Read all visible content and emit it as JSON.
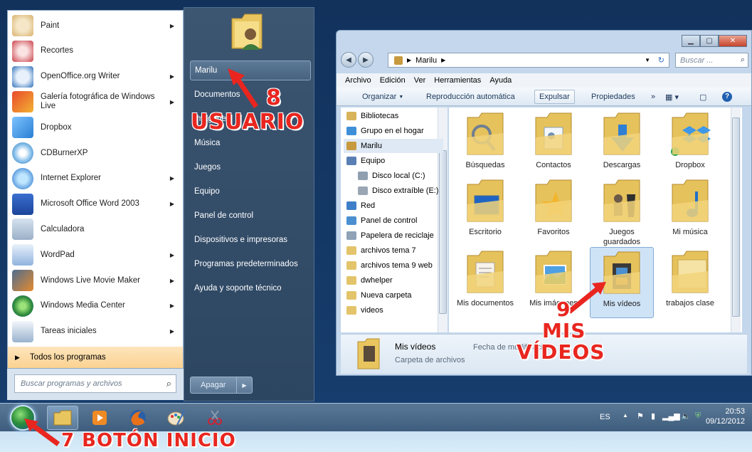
{
  "start_menu": {
    "programs": [
      {
        "label": "Paint",
        "submenu": true,
        "icon": "paint-icon"
      },
      {
        "label": "Recortes",
        "submenu": false,
        "icon": "scissors-icon"
      },
      {
        "label": "OpenOffice.org Writer",
        "submenu": true,
        "icon": "writer-icon"
      },
      {
        "label": "Galería fotográfica de Windows Live",
        "submenu": true,
        "icon": "photo-gallery-icon"
      },
      {
        "label": "Dropbox",
        "submenu": false,
        "icon": "dropbox-icon"
      },
      {
        "label": "CDBurnerXP",
        "submenu": false,
        "icon": "cd-icon"
      },
      {
        "label": "Internet Explorer",
        "submenu": true,
        "icon": "ie-icon"
      },
      {
        "label": "Microsoft Office Word 2003",
        "submenu": true,
        "icon": "word-icon"
      },
      {
        "label": "Calculadora",
        "submenu": false,
        "icon": "calculator-icon"
      },
      {
        "label": "WordPad",
        "submenu": true,
        "icon": "wordpad-icon"
      },
      {
        "label": "Windows Live Movie Maker",
        "submenu": true,
        "icon": "movie-maker-icon"
      },
      {
        "label": "Windows Media Center",
        "submenu": true,
        "icon": "media-center-icon"
      },
      {
        "label": "Tareas iniciales",
        "submenu": true,
        "icon": "tasks-icon"
      }
    ],
    "all_programs": "Todos los programas",
    "search_placeholder": "Buscar programas y archivos",
    "right_items": [
      "Marilu",
      "Documentos",
      "Imágenes",
      "Música",
      "Juegos",
      "Equipo",
      "Panel de control",
      "Dispositivos e impresoras",
      "Programas predeterminados",
      "Ayuda y soporte técnico"
    ],
    "shutdown": "Apagar"
  },
  "explorer": {
    "address": [
      "Marilu"
    ],
    "search_placeholder": "Buscar ...",
    "menu": [
      "Archivo",
      "Edición",
      "Ver",
      "Herramientas",
      "Ayuda"
    ],
    "commands": {
      "organize": "Organizar",
      "autoplay": "Reproducción automática",
      "eject": "Expulsar",
      "properties": "Propiedades"
    },
    "nav_items": [
      {
        "label": "Bibliotecas",
        "color": "#d9b35a"
      },
      {
        "label": "Grupo en el hogar",
        "color": "#3f8fd8"
      },
      {
        "label": "Marilu",
        "color": "#c79a3f"
      },
      {
        "label": "Equipo",
        "color": "#5a7fb5"
      },
      {
        "label": "Disco local (C:)",
        "color": "#8f9fb0"
      },
      {
        "label": "Disco extraíble (E:)",
        "color": "#9aa6b3"
      },
      {
        "label": "Red",
        "color": "#3f7fc8"
      },
      {
        "label": "Panel de control",
        "color": "#4b8fd0"
      },
      {
        "label": "Papelera de reciclaje",
        "color": "#8fa2b6"
      },
      {
        "label": "archivos tema 7",
        "color": "#e3c46a"
      },
      {
        "label": "archivos tema 9 web",
        "color": "#e3c46a"
      },
      {
        "label": "dwhelper",
        "color": "#e3c46a"
      },
      {
        "label": "Nueva carpeta",
        "color": "#e3c46a"
      },
      {
        "label": "videos",
        "color": "#e3c46a"
      }
    ],
    "folders": [
      {
        "label": "Búsquedas",
        "overlay": "magnifier-icon"
      },
      {
        "label": "Contactos",
        "overlay": "contacts-card-icon"
      },
      {
        "label": "Descargas",
        "overlay": "download-arrow-icon"
      },
      {
        "label": "Dropbox",
        "overlay": "dropbox-icon"
      },
      {
        "label": "Escritorio",
        "overlay": "monitor-icon"
      },
      {
        "label": "Favoritos",
        "overlay": "star-icon"
      },
      {
        "label": "Juegos guardados",
        "overlay": "chess-pieces-icon"
      },
      {
        "label": "Mi música",
        "overlay": "music-note-icon"
      },
      {
        "label": "Mis documentos",
        "overlay": "document-icon"
      },
      {
        "label": "Mis imágenes",
        "overlay": "picture-icon"
      },
      {
        "label": "Mis vídeos",
        "overlay": "film-strip-icon"
      },
      {
        "label": "trabajos clase",
        "overlay": "none"
      }
    ],
    "selected_folder": "Mis vídeos",
    "details": {
      "name": "Mis vídeos",
      "type": "Carpeta de archivos",
      "date_label": "Fecha de modificación:"
    }
  },
  "taskbar": {
    "language": "ES",
    "time": "20:53",
    "date": "09/12/2012"
  },
  "annotations": {
    "a7": "7 BOTÓN INICIO",
    "a8_num": "8",
    "a8_text": "USUARIO",
    "a9_num": "9",
    "a9_l1": "MIS",
    "a9_l2": "VÍDEOS"
  },
  "colors": {
    "annotation": "#e8261f",
    "start_menu_right": "#3c5672",
    "taskbar": "#4a6a8a"
  }
}
